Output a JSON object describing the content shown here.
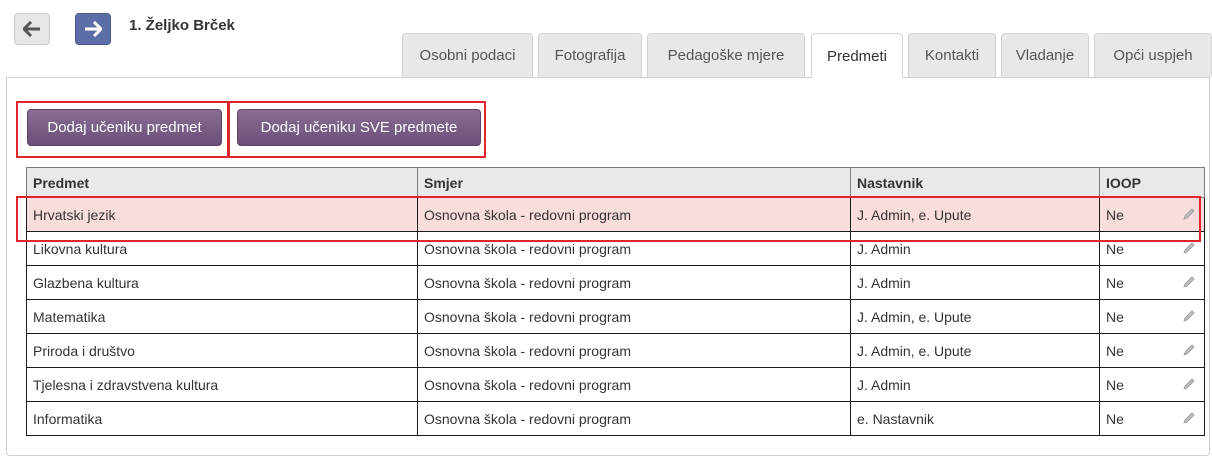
{
  "header": {
    "student_name": "1. Željko Brček"
  },
  "nav": {
    "back_icon": "arrow-left-icon",
    "forward_icon": "arrow-right-icon"
  },
  "tabs": [
    {
      "label": "Osobni podaci",
      "active": false
    },
    {
      "label": "Fotografija",
      "active": false
    },
    {
      "label": "Pedagoške mjere",
      "active": false
    },
    {
      "label": "Predmeti",
      "active": true
    },
    {
      "label": "Kontakti",
      "active": false
    },
    {
      "label": "Vladanje",
      "active": false
    },
    {
      "label": "Opći uspjeh",
      "active": false
    }
  ],
  "actions": {
    "add_subject": "Dodaj učeniku predmet",
    "add_all_subjects": "Dodaj učeniku SVE predmete"
  },
  "table": {
    "headers": [
      "Predmet",
      "Smjer",
      "Nastavnik",
      "IOOP"
    ],
    "rows": [
      {
        "predmet": "Hrvatski jezik",
        "smjer": "Osnovna škola - redovni program",
        "nastavnik": "J. Admin, e. Upute",
        "ioop": "Ne"
      },
      {
        "predmet": "Likovna kultura",
        "smjer": "Osnovna škola - redovni program",
        "nastavnik": "J. Admin",
        "ioop": "Ne"
      },
      {
        "predmet": "Glazbena kultura",
        "smjer": "Osnovna škola - redovni program",
        "nastavnik": "J. Admin",
        "ioop": "Ne"
      },
      {
        "predmet": "Matematika",
        "smjer": "Osnovna škola - redovni program",
        "nastavnik": "J. Admin, e. Upute",
        "ioop": "Ne"
      },
      {
        "predmet": "Priroda i društvo",
        "smjer": "Osnovna škola - redovni program",
        "nastavnik": "J. Admin, e. Upute",
        "ioop": "Ne"
      },
      {
        "predmet": "Tjelesna i zdravstvena kultura",
        "smjer": "Osnovna škola - redovni program",
        "nastavnik": "J. Admin",
        "ioop": "Ne"
      },
      {
        "predmet": "Informatika",
        "smjer": "Osnovna škola - redovni program",
        "nastavnik": "e. Nastavnik",
        "ioop": "Ne"
      }
    ]
  },
  "colors": {
    "button": "#7a5e87",
    "highlight_row": "#f9dcdc",
    "annotation_red": "#e0262d",
    "forward_button": "#5b6fa6"
  }
}
